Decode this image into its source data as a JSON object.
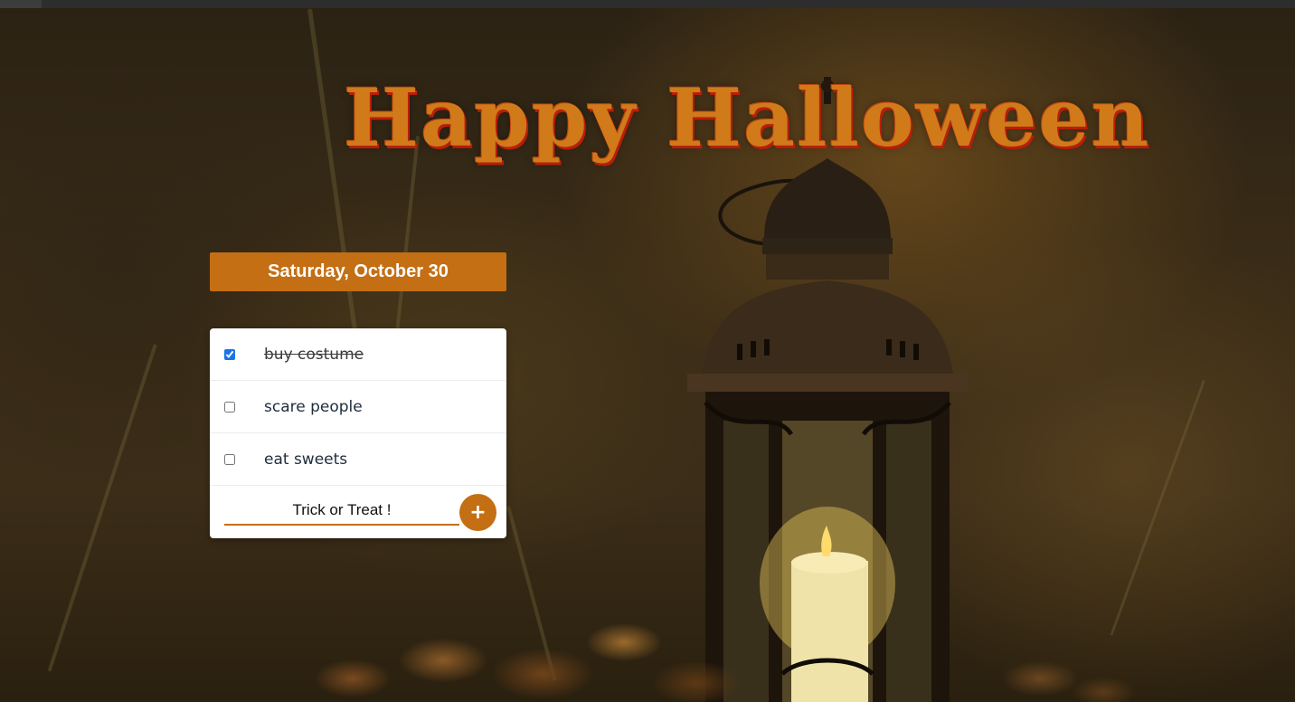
{
  "header": {
    "title": "Happy Halloween"
  },
  "date_banner": {
    "text": "Saturday, October 30"
  },
  "todos": [
    {
      "label": "buy costume",
      "checked": true
    },
    {
      "label": "scare people",
      "checked": false
    },
    {
      "label": "eat sweets",
      "checked": false
    }
  ],
  "new_item": {
    "value": "Trick or Treat !",
    "add_button_label": "+"
  },
  "colors": {
    "accent": "#c46f14",
    "title_fill": "#d07a1a",
    "title_outline": "#b81e0a",
    "checkbox_checked": "#1a73e8"
  },
  "icons": {
    "add": "plus-icon",
    "background": "lantern-forest-image"
  }
}
